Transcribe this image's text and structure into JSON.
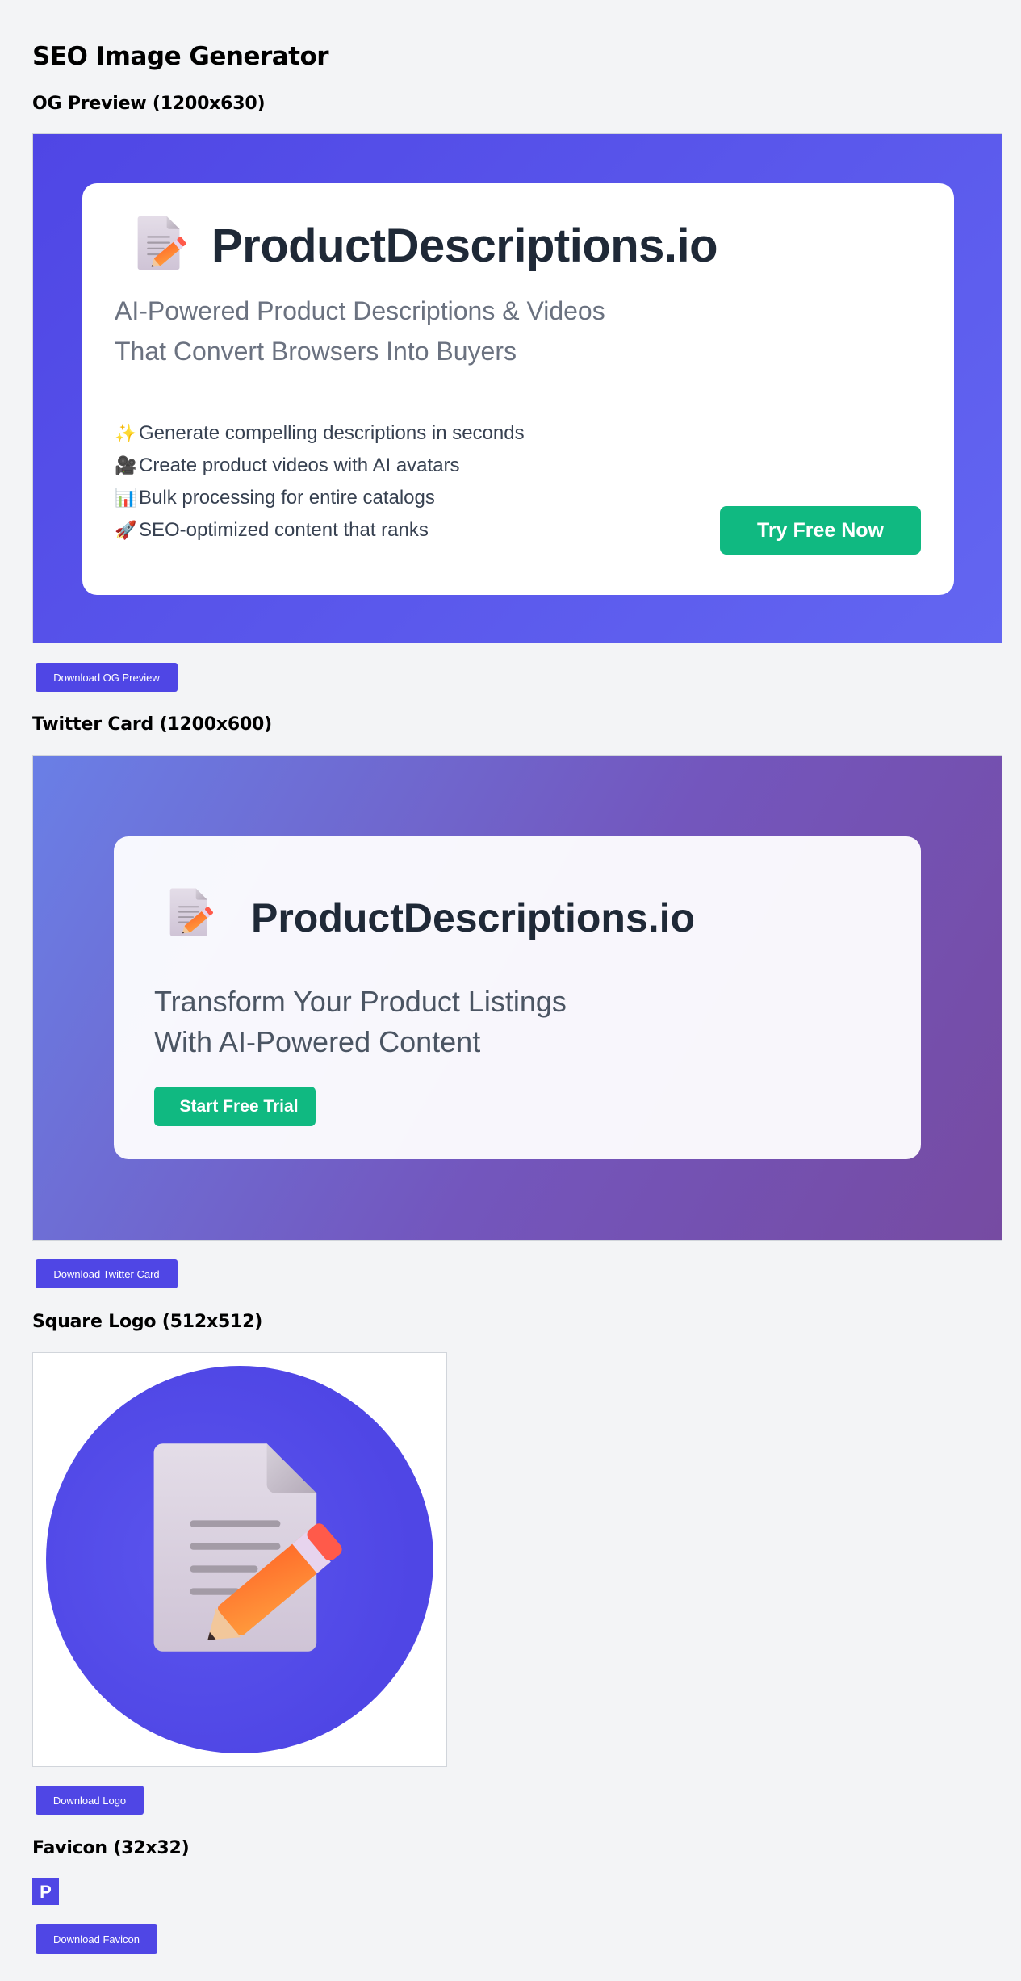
{
  "page": {
    "title": "SEO Image Generator"
  },
  "og": {
    "section_title": "OG Preview (1200x630)",
    "brand": "ProductDescriptions.io",
    "tagline": [
      "AI-Powered Product Descriptions & Videos",
      "That Convert Browsers Into Buyers"
    ],
    "features": [
      {
        "emoji": "✨",
        "text": "Generate compelling descriptions in seconds"
      },
      {
        "emoji": "🎥",
        "text": "Create product videos with AI avatars"
      },
      {
        "emoji": "📊",
        "text": "Bulk processing for entire catalogs"
      },
      {
        "emoji": "🚀",
        "text": "SEO-optimized content that ranks"
      }
    ],
    "cta": "Try Free Now",
    "download_label": "Download OG Preview"
  },
  "twitter": {
    "section_title": "Twitter Card (1200x600)",
    "brand": "ProductDescriptions.io",
    "tagline": [
      "Transform Your Product Listings",
      "With AI-Powered Content"
    ],
    "cta": "Start Free Trial",
    "download_label": "Download Twitter Card"
  },
  "logo": {
    "section_title": "Square Logo (512x512)",
    "icon": "document-pencil-icon",
    "download_label": "Download Logo"
  },
  "favicon": {
    "section_title": "Favicon (32x32)",
    "letter": "P",
    "download_label": "Download Favicon"
  },
  "colors": {
    "primary": "#4f46e5",
    "cta_green": "#10b981",
    "brand_text": "#1f2937",
    "twitter_gradient_start": "#667eea",
    "twitter_gradient_end": "#764ba2"
  }
}
